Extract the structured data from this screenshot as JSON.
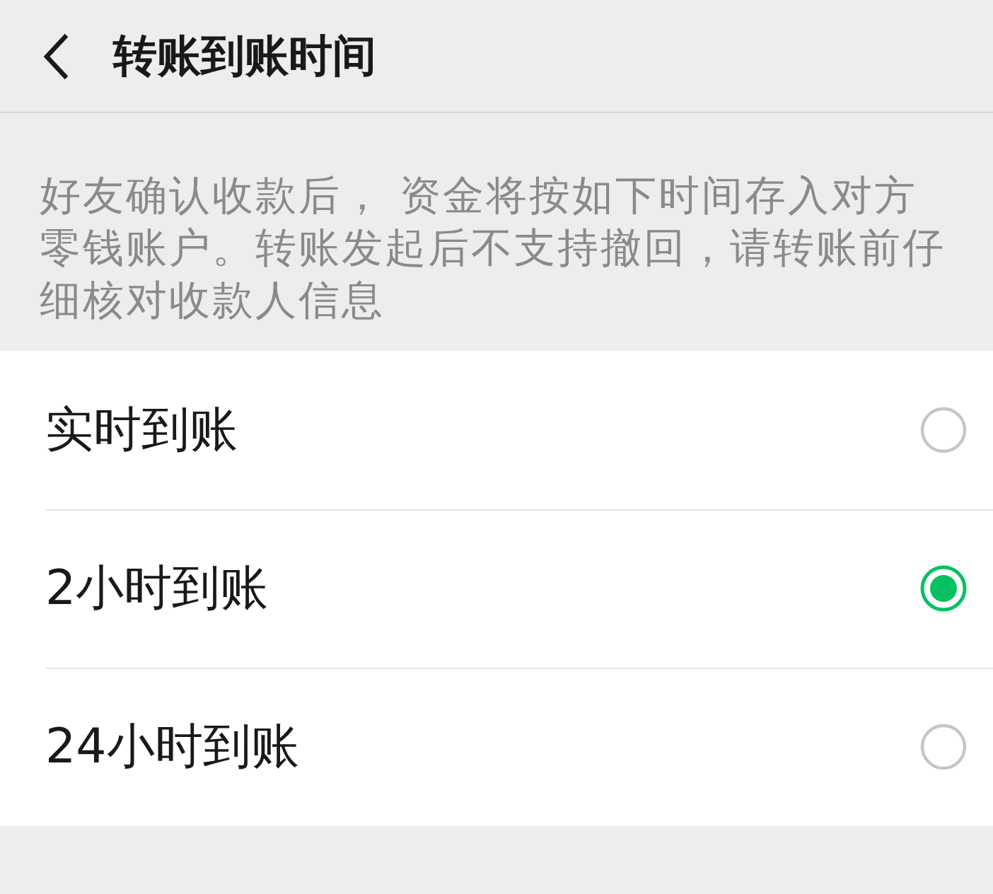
{
  "header": {
    "title": "转账到账时间"
  },
  "description": "好友确认收款后， 资金将按如下时间存入对方零钱账户。转账发起后不支持撤回，请转账前仔细核对收款人信息",
  "options": [
    {
      "label": "实时到账",
      "selected": false
    },
    {
      "label": "2小时到账",
      "selected": true
    },
    {
      "label": "24小时到账",
      "selected": false
    }
  ]
}
